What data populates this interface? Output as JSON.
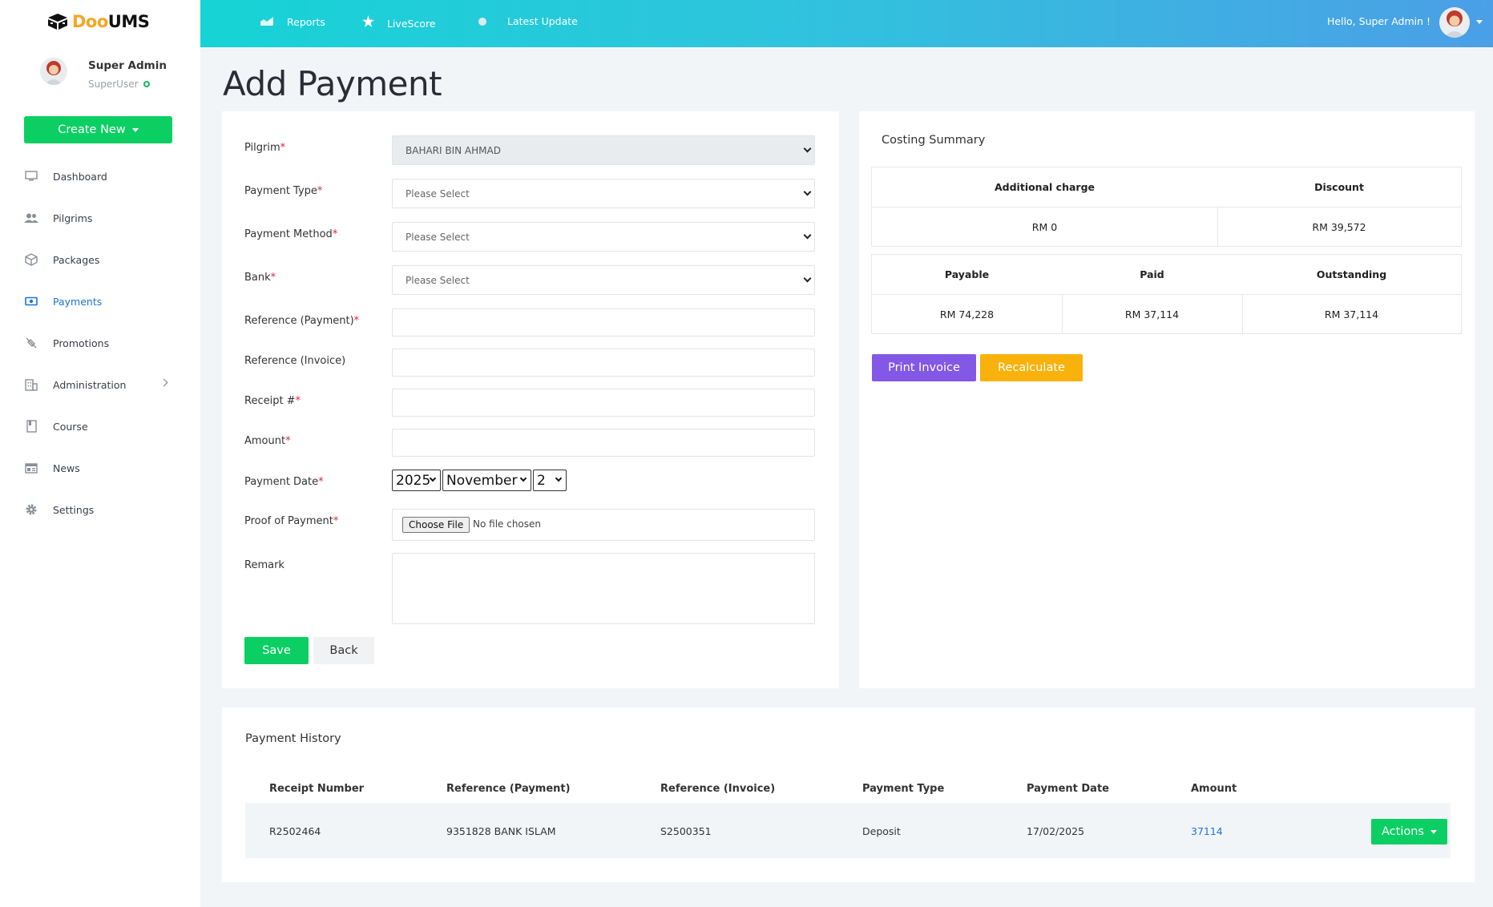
{
  "app": {
    "logo_part1": "Doo",
    "logo_part2": "UMS",
    "brand_color": "#f5a623",
    "accent_color": "#0bcf63"
  },
  "sidebar": {
    "user_name": "Super Admin",
    "user_role": "SuperUser",
    "create_new_label": "Create New",
    "items": [
      {
        "label": "Dashboard",
        "icon": "monitor-icon"
      },
      {
        "label": "Pilgrims",
        "icon": "users-icon"
      },
      {
        "label": "Packages",
        "icon": "box-icon"
      },
      {
        "label": "Payments",
        "icon": "money-icon",
        "active": true
      },
      {
        "label": "Promotions",
        "icon": "tag-icon"
      },
      {
        "label": "Administration",
        "icon": "building-icon"
      },
      {
        "label": "Course",
        "icon": "book-icon"
      },
      {
        "label": "News",
        "icon": "news-icon"
      },
      {
        "label": "Settings",
        "icon": "gear-icon"
      }
    ]
  },
  "topbar": {
    "reports": "Reports",
    "livescore": "LiveScore",
    "latest_update": "Latest Update",
    "greeting": "Hello, Super Admin !"
  },
  "page": {
    "title": "Add Payment"
  },
  "form": {
    "pilgrim_label": "Pilgrim",
    "pilgrim_value": "BAHARI BIN AHMAD",
    "payment_type_label": "Payment Type",
    "payment_type_value": "Please Select",
    "payment_method_label": "Payment Method",
    "payment_method_value": "Please Select",
    "bank_label": "Bank",
    "bank_value": "Please Select",
    "ref_payment_label": "Reference (Payment)",
    "ref_invoice_label": "Reference (Invoice)",
    "receipt_label": "Receipt #",
    "amount_label": "Amount",
    "payment_date_label": "Payment Date",
    "date_year": "2025",
    "date_month": "November",
    "date_day": "2",
    "proof_label": "Proof of Payment",
    "choose_file": "Choose File",
    "no_file": "No file chosen",
    "remark_label": "Remark",
    "save_label": "Save",
    "back_label": "Back",
    "required_mark": "*"
  },
  "costing": {
    "heading": "Costing Summary",
    "additional_charge_label": "Additional charge",
    "discount_label": "Discount",
    "additional_charge_value": "RM 0",
    "discount_value": "RM 39,572",
    "payable_label": "Payable",
    "paid_label": "Paid",
    "outstanding_label": "Outstanding",
    "payable_value": "RM 74,228",
    "paid_value": "RM 37,114",
    "outstanding_value": "RM 37,114",
    "print_invoice_label": "Print Invoice",
    "recalculate_label": "Recalculate"
  },
  "history": {
    "heading": "Payment History",
    "columns": [
      "Receipt Number",
      "Reference (Payment)",
      "Reference (Invoice)",
      "Payment Type",
      "Payment Date",
      "Amount"
    ],
    "rows": [
      {
        "receipt": "R2502464",
        "ref_payment": "9351828 BANK ISLAM",
        "ref_invoice": "S2500351",
        "type": "Deposit",
        "date": "17/02/2025",
        "amount": "37114",
        "actions_label": "Actions"
      }
    ]
  }
}
